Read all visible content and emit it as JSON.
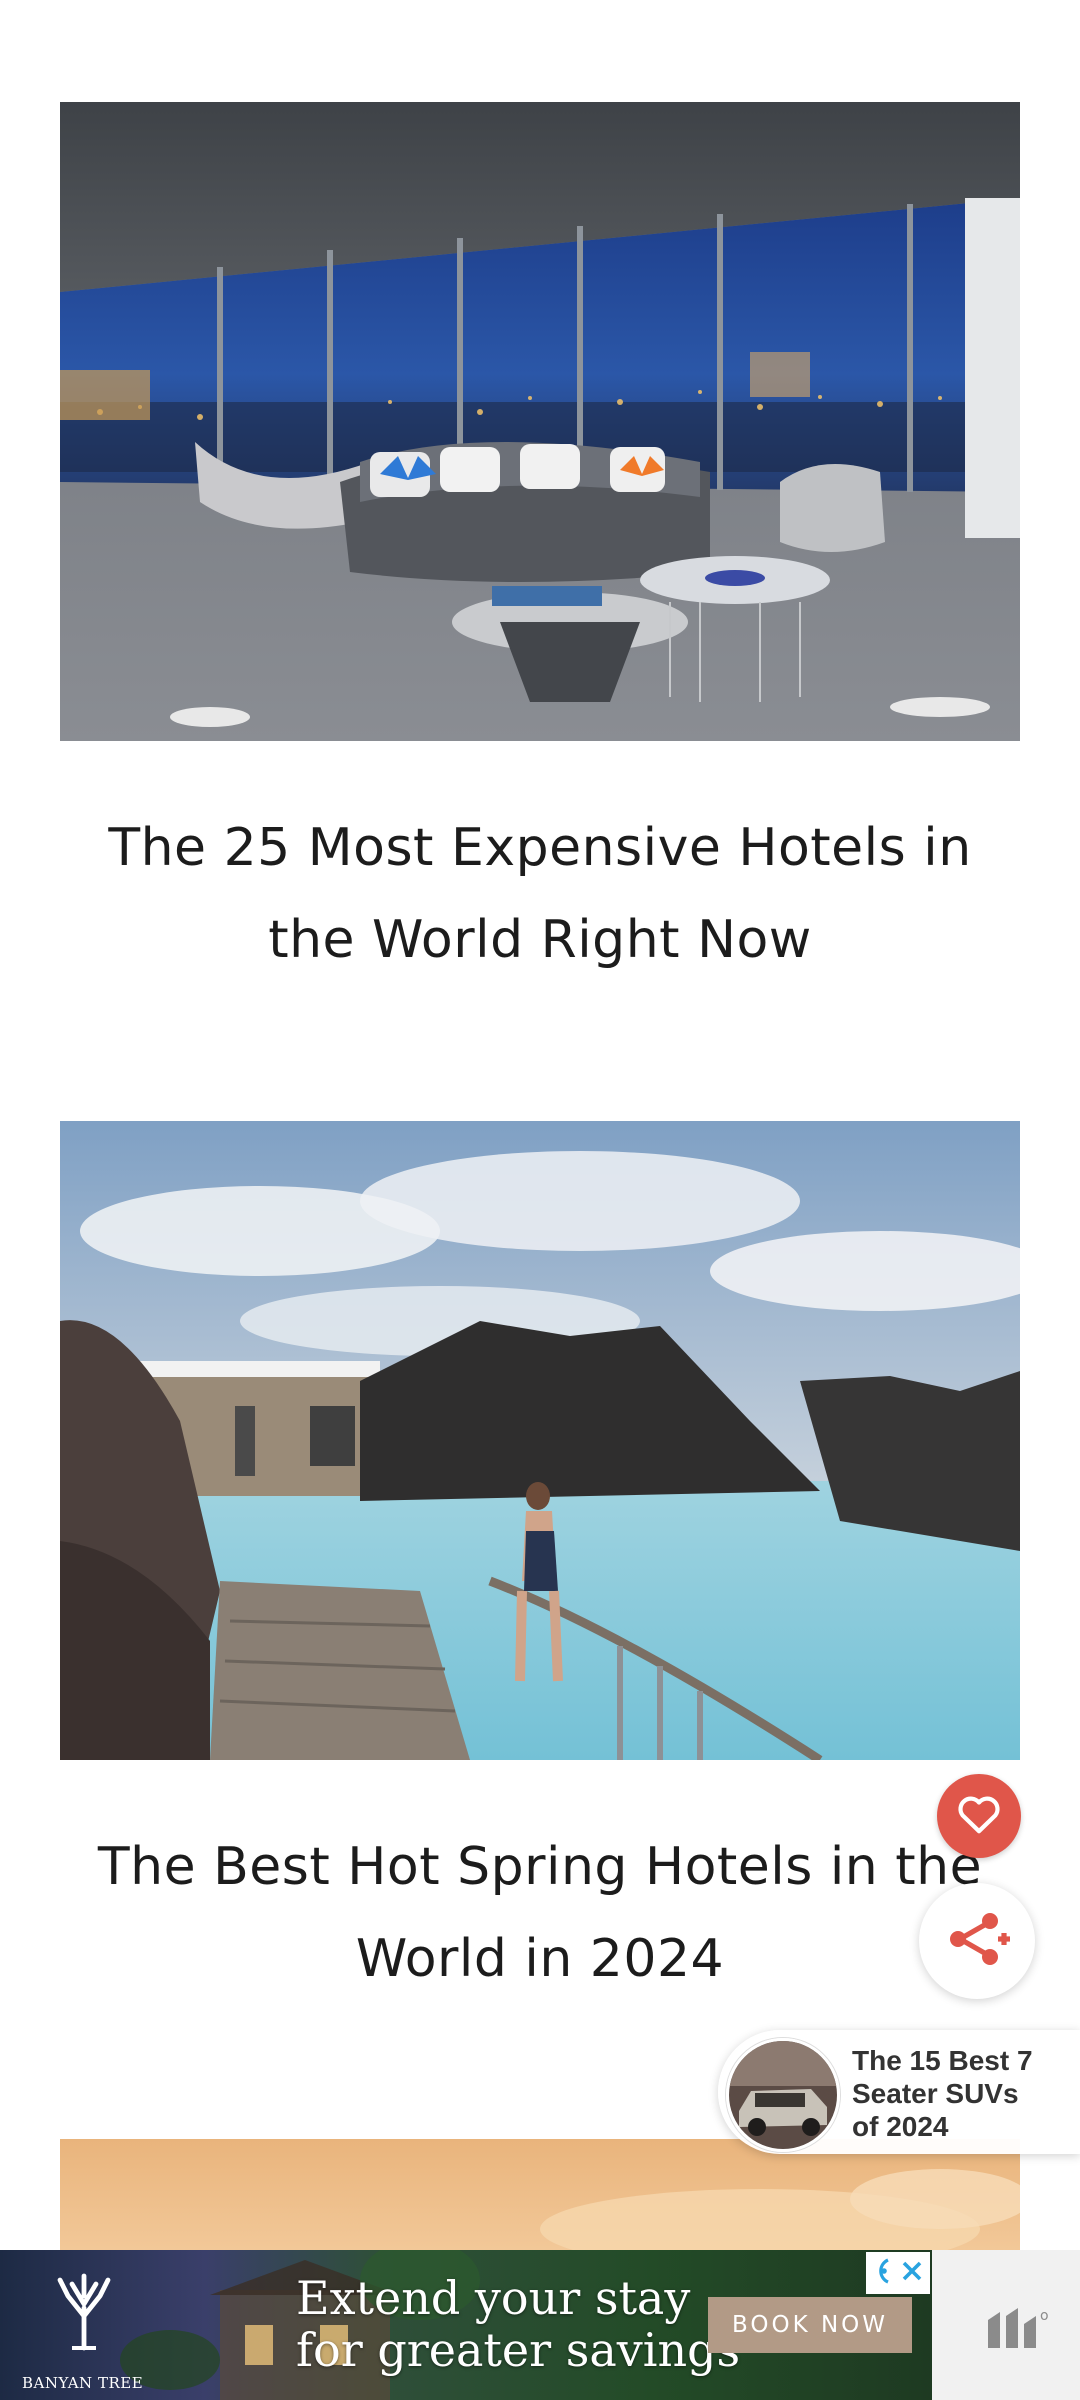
{
  "articles": [
    {
      "title_line1": "The 25 Most Expensive Hotels in",
      "title_line2": "the World Right Now"
    },
    {
      "title_line1": "The Best Hot Spring Hotels in the",
      "title_line2": "World in 2024"
    }
  ],
  "fabs": {
    "favorite_icon": "heart-icon",
    "share_icon": "share-icon",
    "accent": "#e0564a"
  },
  "recommendation": {
    "text_line1": "The 15 Best 7",
    "text_line2": "Seater SUVs",
    "text_line3": "of 2024"
  },
  "ad": {
    "brand": "BANYAN TREE",
    "headline_line1": "Extend your stay",
    "headline_line2": "for greater savings",
    "cta": "BOOK NOW"
  }
}
